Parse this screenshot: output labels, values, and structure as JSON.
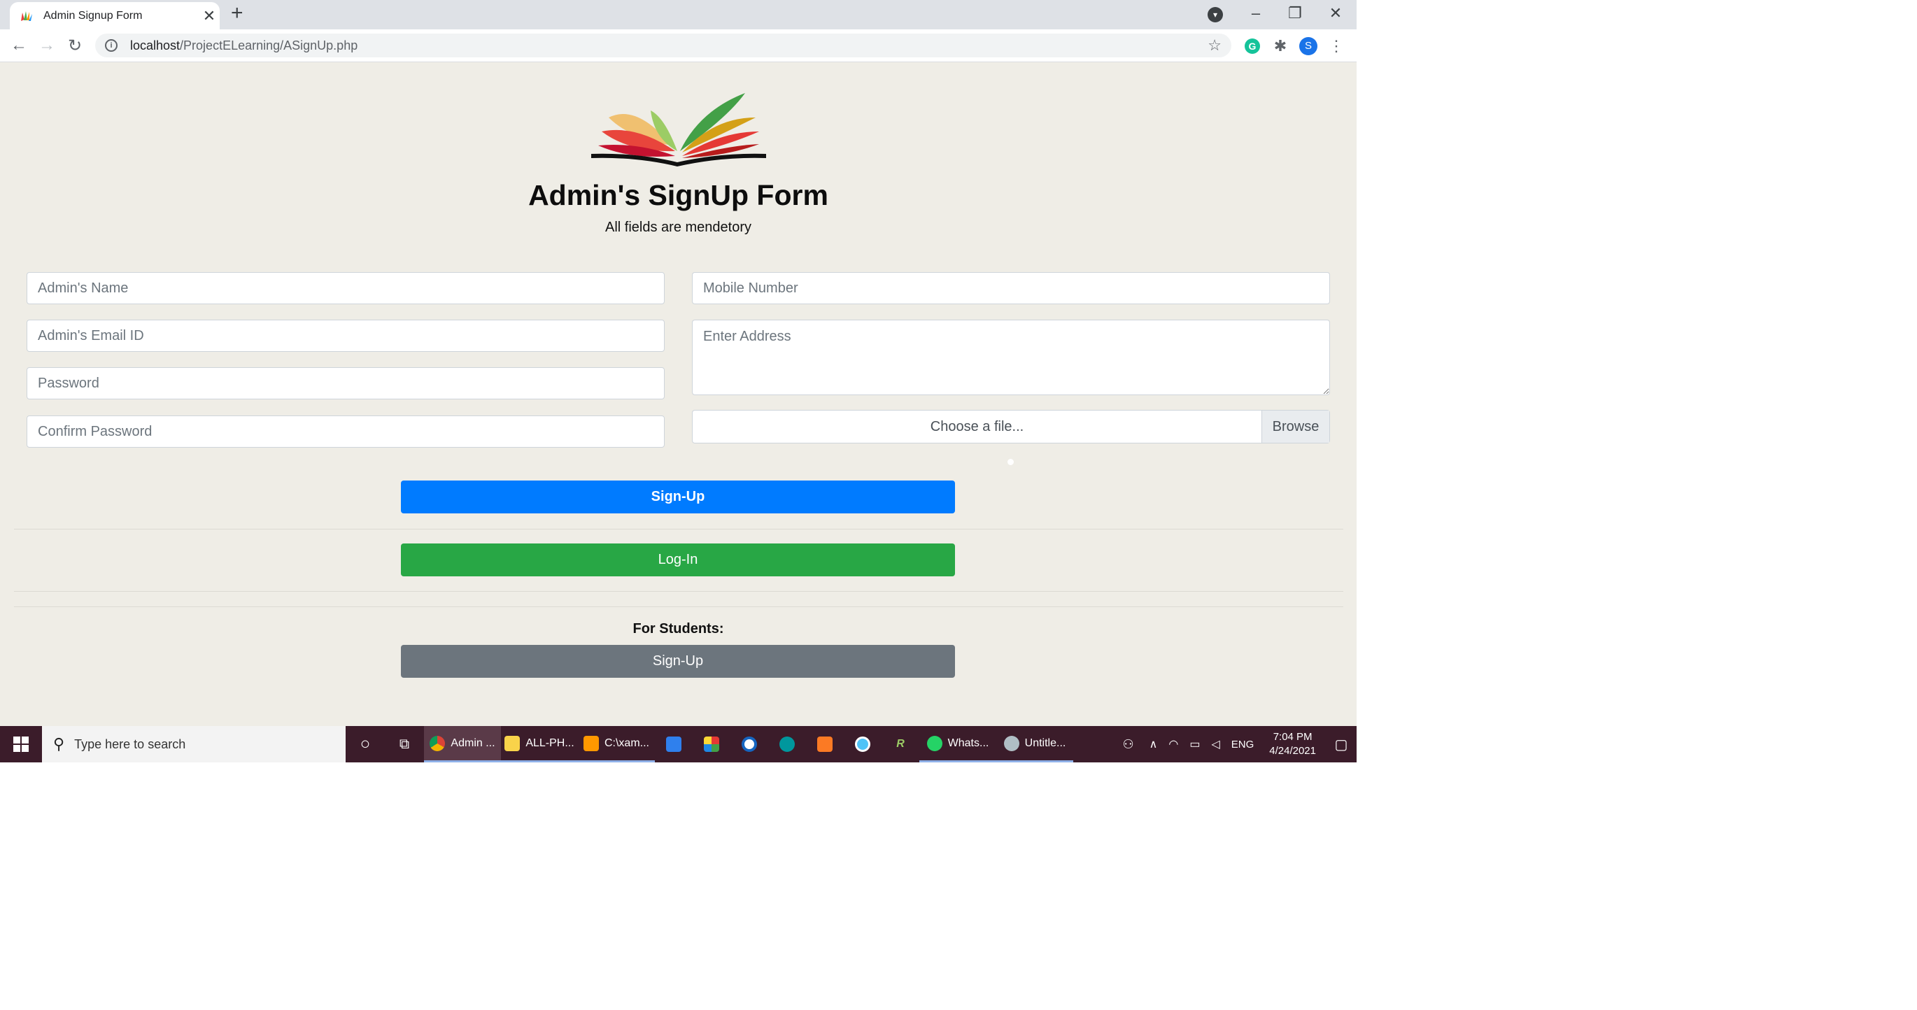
{
  "browser": {
    "tab_title": "Admin Signup Form",
    "tab_close": "✕",
    "new_tab": "+",
    "window_controls": [
      "–",
      "❐",
      "✕"
    ],
    "url_host": "localhost",
    "url_path": "/ProjectELearning/ASignUp.php",
    "avatar_letter": "S",
    "grammarly_letter": "G"
  },
  "page": {
    "title": "Admin's SignUp Form",
    "subtitle": "All fields are mendetory",
    "fields": {
      "name_placeholder": "Admin's Name",
      "email_placeholder": "Admin's Email ID",
      "password_placeholder": "Password",
      "confirm_password_placeholder": "Confirm Password",
      "mobile_placeholder": "Mobile Number",
      "address_placeholder": "Enter Address"
    },
    "file": {
      "label": "Choose a file...",
      "browse": "Browse"
    },
    "signup_button": "Sign-Up",
    "login_button": "Log-In",
    "students_label": "For Students:",
    "student_signup_button": "Sign-Up"
  },
  "colors": {
    "primary": "#007bff",
    "success": "#28a745",
    "secondary": "#6c757d",
    "page_bg": "#efede6",
    "taskbar": "#3b1c2a"
  },
  "taskbar": {
    "search_placeholder": "Type here to search",
    "apps": [
      {
        "label": "Admin ...",
        "icon": "chrome-icon"
      },
      {
        "label": "ALL-PH...",
        "icon": "file-explorer-icon"
      },
      {
        "label": "C:\\xam...",
        "icon": "sublime-text-icon"
      },
      {
        "label": "",
        "icon": "vscode-icon"
      },
      {
        "label": "",
        "icon": "app-grid-icon"
      },
      {
        "label": "",
        "icon": "app-blue-icon"
      },
      {
        "label": "",
        "icon": "arduino-icon"
      },
      {
        "label": "",
        "icon": "xampp-icon"
      },
      {
        "label": "",
        "icon": "app-globe-icon"
      },
      {
        "label": "",
        "icon": "rstudio-icon"
      },
      {
        "label": "Whats...",
        "icon": "whatsapp-icon"
      },
      {
        "label": "Untitle...",
        "icon": "paint-icon"
      }
    ],
    "language": "ENG",
    "time": "7:04 PM",
    "date": "4/24/2021"
  }
}
